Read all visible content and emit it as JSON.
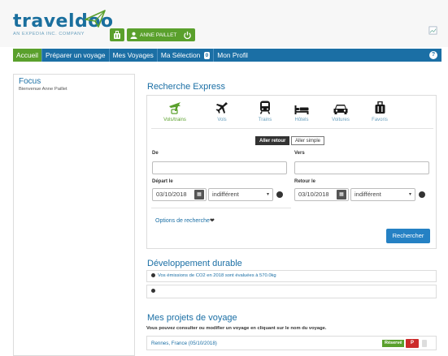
{
  "header": {
    "logo": "traveldoo",
    "logo_sub": "AN EXPEDIA INC. COMPANY",
    "user_name": "ANNE PAILLET"
  },
  "nav": {
    "items": [
      "Accueil",
      "Préparer un voyage",
      "Mes Voyages",
      "Ma Sélection",
      "Mon Profil"
    ],
    "selection_count": "0",
    "help": "?"
  },
  "focus": {
    "title": "Focus",
    "welcome": "Bienvenue Anne Paillet"
  },
  "search": {
    "title": "Recherche Express",
    "tabs": [
      {
        "label": "Vols/trains",
        "icon": "plane-train-icon"
      },
      {
        "label": "Vols",
        "icon": "plane-icon"
      },
      {
        "label": "Trains",
        "icon": "train-icon"
      },
      {
        "label": "Hôtels",
        "icon": "bed-icon"
      },
      {
        "label": "Voitures",
        "icon": "car-icon"
      },
      {
        "label": "Favoris",
        "icon": "luggage-icon"
      }
    ],
    "trip_type_roundtrip": "Aller retour",
    "trip_type_oneway": "Aller simple",
    "from_label": "De",
    "to_label": "Vers",
    "from_value": "",
    "to_value": "",
    "depart_label": "Départ le",
    "return_label": "Retour le",
    "depart_date": "03/10/2018",
    "return_date": "03/10/2018",
    "depart_time": "indifférent",
    "return_time": "indifférent",
    "options_label": "Options de recherche",
    "search_button": "Rechercher",
    "active_tab_color": "#5aa02c"
  },
  "sustainability": {
    "title": "Développement durable",
    "emissions_text": "Vos émissions de CO2 en 2018 sont évaluées à 570.0kg"
  },
  "projects": {
    "title": "Mes projets de voyage",
    "subtitle": "Vous pouvez consulter ou modifier un voyage en cliquant sur le nom du voyage.",
    "trips": [
      {
        "name": "Rennes, France (05/10/2018)",
        "status": "Réservé",
        "badge": "P"
      }
    ]
  },
  "colors": {
    "brand_blue": "#1b6fa5",
    "accent_green": "#5aa02c",
    "button_blue": "#2581c4",
    "badge_red": "#cc2a2a"
  }
}
